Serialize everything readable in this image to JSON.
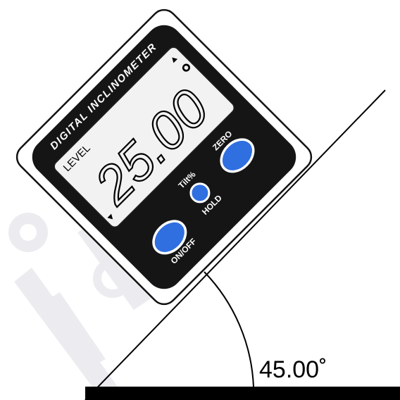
{
  "device": {
    "title": "DIGITAL INCLINOMETER",
    "mode_label": "LEVEL",
    "reading": "25.00",
    "degree_symbol": "°",
    "buttons": {
      "zero_label": "ZERO",
      "onoff_label": "ON/OFF",
      "tilt_label": "Tilt%",
      "hold_label": "HOLD"
    }
  },
  "surface": {
    "angle_label": "45.00˚"
  },
  "colors": {
    "button_blue": "#2f6fe0",
    "device_outline": "#111111",
    "screen_bg": "#f2f2f2",
    "panel_dark": "#151515",
    "watermark": "#ececf0"
  }
}
